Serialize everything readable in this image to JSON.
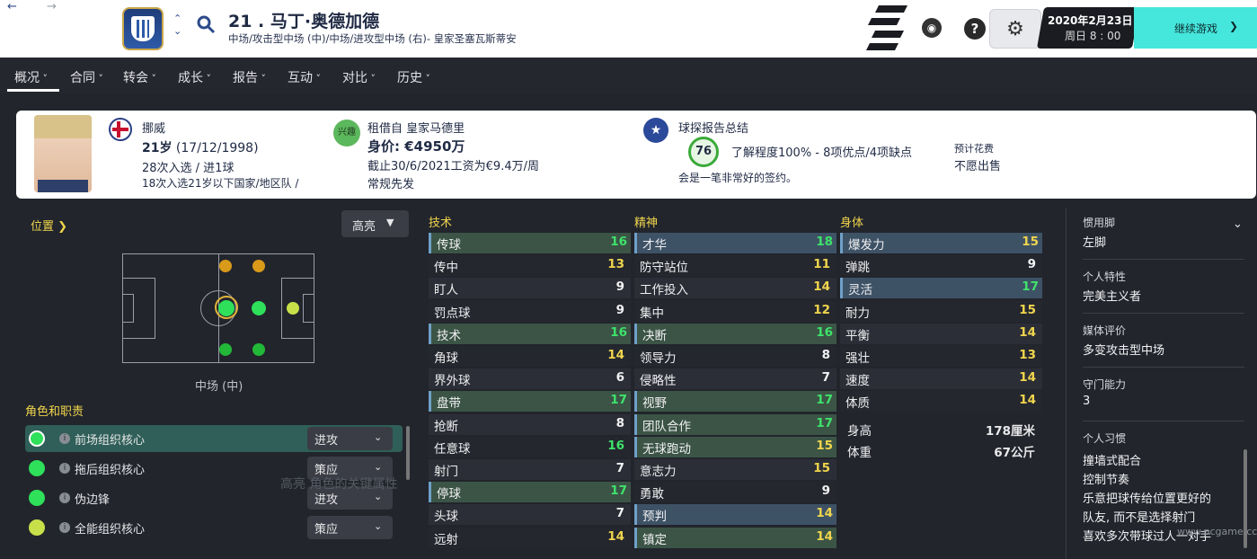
{
  "topbar": {
    "player_number_name": "21 . 马丁·奥德加德",
    "positions": "中场/攻击型中场 (中)/中场/进攻型中场 (右)- 皇家圣塞瓦斯蒂安",
    "date": "2020年2月23日",
    "weekday_time": "周日 8 : 00",
    "continue_label": "继续游戏",
    "help_label": "?"
  },
  "tabs": [
    "概况",
    "合同",
    "转会",
    "成长",
    "报告",
    "互动",
    "对比",
    "历史"
  ],
  "info": {
    "nationality": "挪威",
    "age_prefix": "21岁",
    "age_dob": " (17/12/1998)",
    "caps": "28次入选 / 进1球",
    "u21_caps": "18次入选21岁以下国家/地区队 /",
    "interest_badge": "兴趣",
    "loan": "租借自 皇家马德里",
    "value": "身价: €4950万",
    "wage": "截止30/6/2021工资为€9.4万/周",
    "status": "常规先发",
    "scout_title": "球探报告总结",
    "scout_rating": "76",
    "scout_knowledge": "了解程度100% - 8项优点/4项缺点",
    "scout_summary": "会是一笔非常好的签约。",
    "fee_label": "预计花费",
    "fee_value": "不愿出售"
  },
  "position_panel": {
    "title": "位置",
    "highlight_label": "高亮",
    "position_label": "中场 (中)",
    "roles_title": "角色和职责",
    "ghost_text": "高亮 角色的关键属性"
  },
  "roles": [
    {
      "name": "前场组织核心",
      "duty": "进攻",
      "color": "#2ee05a"
    },
    {
      "name": "拖后组织核心",
      "duty": "策应",
      "color": "#2ee05a"
    },
    {
      "name": "伪边锋",
      "duty": "进攻",
      "color": "#2ee05a"
    },
    {
      "name": "全能组织核心",
      "duty": "策应",
      "color": "#c7e04a"
    }
  ],
  "attributes": {
    "technical_title": "技术",
    "mental_title": "精神",
    "physical_title": "身体",
    "technical": [
      {
        "name": "传球",
        "value": "16",
        "hl": true
      },
      {
        "name": "传中",
        "value": "13",
        "hl": false
      },
      {
        "name": "盯人",
        "value": "9",
        "hl": false
      },
      {
        "name": "罚点球",
        "value": "9",
        "hl": false
      },
      {
        "name": "技术",
        "value": "16",
        "hl": true
      },
      {
        "name": "角球",
        "value": "14",
        "hl": false
      },
      {
        "name": "界外球",
        "value": "6",
        "hl": false
      },
      {
        "name": "盘带",
        "value": "17",
        "hl": true
      },
      {
        "name": "抢断",
        "value": "8",
        "hl": false
      },
      {
        "name": "任意球",
        "value": "16",
        "hl": false
      },
      {
        "name": "射门",
        "value": "7",
        "hl": false
      },
      {
        "name": "停球",
        "value": "17",
        "hl": true
      },
      {
        "name": "头球",
        "value": "7",
        "hl": false
      },
      {
        "name": "远射",
        "value": "14",
        "hl": false
      }
    ],
    "mental": [
      {
        "name": "才华",
        "value": "18",
        "hl": "blue"
      },
      {
        "name": "防守站位",
        "value": "11",
        "hl": ""
      },
      {
        "name": "工作投入",
        "value": "14",
        "hl": ""
      },
      {
        "name": "集中",
        "value": "12",
        "hl": ""
      },
      {
        "name": "决断",
        "value": "16",
        "hl": "green"
      },
      {
        "name": "领导力",
        "value": "8",
        "hl": ""
      },
      {
        "name": "侵略性",
        "value": "7",
        "hl": ""
      },
      {
        "name": "视野",
        "value": "17",
        "hl": "green"
      },
      {
        "name": "团队合作",
        "value": "17",
        "hl": "green"
      },
      {
        "name": "无球跑动",
        "value": "15",
        "hl": "green"
      },
      {
        "name": "意志力",
        "value": "15",
        "hl": ""
      },
      {
        "name": "勇敢",
        "value": "9",
        "hl": ""
      },
      {
        "name": "预判",
        "value": "14",
        "hl": "blue"
      },
      {
        "name": "镇定",
        "value": "14",
        "hl": "green"
      }
    ],
    "physical": [
      {
        "name": "爆发力",
        "value": "15",
        "hl": "blue"
      },
      {
        "name": "弹跳",
        "value": "9",
        "hl": ""
      },
      {
        "name": "灵活",
        "value": "17",
        "hl": "blue"
      },
      {
        "name": "耐力",
        "value": "15",
        "hl": ""
      },
      {
        "name": "平衡",
        "value": "14",
        "hl": ""
      },
      {
        "name": "强壮",
        "value": "13",
        "hl": ""
      },
      {
        "name": "速度",
        "value": "14",
        "hl": ""
      },
      {
        "name": "体质",
        "value": "14",
        "hl": ""
      }
    ],
    "height_label": "身高",
    "height_value": "178厘米",
    "weight_label": "体重",
    "weight_value": "67公斤"
  },
  "right_panel": {
    "foot_label": "惯用脚",
    "foot_value": "左脚",
    "personality_label": "个人特性",
    "personality_value": "完美主义者",
    "media_label": "媒体评价",
    "media_value": "多变攻击型中场",
    "gk_label": "守门能力",
    "gk_value": "3",
    "habits_label": "个人习惯",
    "habits": [
      "撞墙式配合",
      "控制节奏",
      "乐意把球传给位置更好的",
      "队友, 而不是选择射门",
      "喜欢多次带球过人一对手"
    ]
  },
  "watermark": "www.pcgame.cc"
}
